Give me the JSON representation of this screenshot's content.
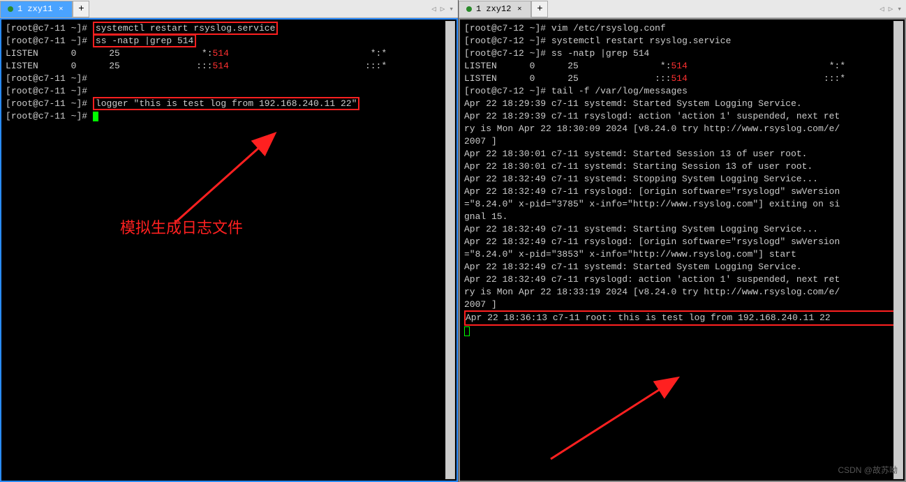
{
  "left": {
    "tab": {
      "label": "1 zxy11",
      "active": true
    },
    "prompt": {
      "user": "root",
      "host": "c7-11",
      "path": "~",
      "symbol": "#"
    },
    "commands": [
      "systemctl restart rsyslog.service",
      "ss -natp |grep 514",
      "",
      "",
      "logger \"this is test log from 192.168.240.11 22\"",
      ""
    ],
    "ss_rows": [
      {
        "state": "LISTEN",
        "recv": "0",
        "send": "25",
        "local_prefix": "*:",
        "local_port": "514",
        "peer": "*:*"
      },
      {
        "state": "LISTEN",
        "recv": "0",
        "send": "25",
        "local_prefix": ":::",
        "local_port": "514",
        "peer": ":::*"
      }
    ],
    "annotation": "模拟生成日志文件"
  },
  "right": {
    "tab": {
      "label": "1 zxy12",
      "active": false
    },
    "prompt": {
      "user": "root",
      "host": "c7-12",
      "path": "~",
      "symbol": "#"
    },
    "commands": [
      "vim /etc/rsyslog.conf",
      "systemctl restart rsyslog.service",
      "ss -natp |grep 514",
      "tail -f /var/log/messages"
    ],
    "ss_rows": [
      {
        "state": "LISTEN",
        "recv": "0",
        "send": "25",
        "local_prefix": "*:",
        "local_port": "514",
        "peer": "*:*"
      },
      {
        "state": "LISTEN",
        "recv": "0",
        "send": "25",
        "local_prefix": ":::",
        "local_port": "514",
        "peer": ":::*"
      }
    ],
    "log_lines": [
      "Apr 22 18:29:39 c7-11 systemd: Started System Logging Service.",
      "Apr 22 18:29:39 c7-11 rsyslogd: action 'action 1' suspended, next ret",
      "ry is Mon Apr 22 18:30:09 2024 [v8.24.0 try http://www.rsyslog.com/e/",
      "2007 ]",
      "Apr 22 18:30:01 c7-11 systemd: Started Session 13 of user root.",
      "Apr 22 18:30:01 c7-11 systemd: Starting Session 13 of user root.",
      "Apr 22 18:32:49 c7-11 systemd: Stopping System Logging Service...",
      "Apr 22 18:32:49 c7-11 rsyslogd: [origin software=\"rsyslogd\" swVersion",
      "=\"8.24.0\" x-pid=\"3785\" x-info=\"http://www.rsyslog.com\"] exiting on si",
      "gnal 15.",
      "Apr 22 18:32:49 c7-11 systemd: Starting System Logging Service...",
      "Apr 22 18:32:49 c7-11 rsyslogd: [origin software=\"rsyslogd\" swVersion",
      "=\"8.24.0\" x-pid=\"3853\" x-info=\"http://www.rsyslog.com\"] start",
      "Apr 22 18:32:49 c7-11 systemd: Started System Logging Service.",
      "Apr 22 18:32:49 c7-11 rsyslogd: action 'action 1' suspended, next ret",
      "ry is Mon Apr 22 18:33:19 2024 [v8.24.0 try http://www.rsyslog.com/e/",
      "2007 ]"
    ],
    "highlighted_log": "Apr 22 18:36:13 c7-11 root: this is test log from 192.168.240.11 22"
  },
  "watermark": "CSDN @故苏呦"
}
